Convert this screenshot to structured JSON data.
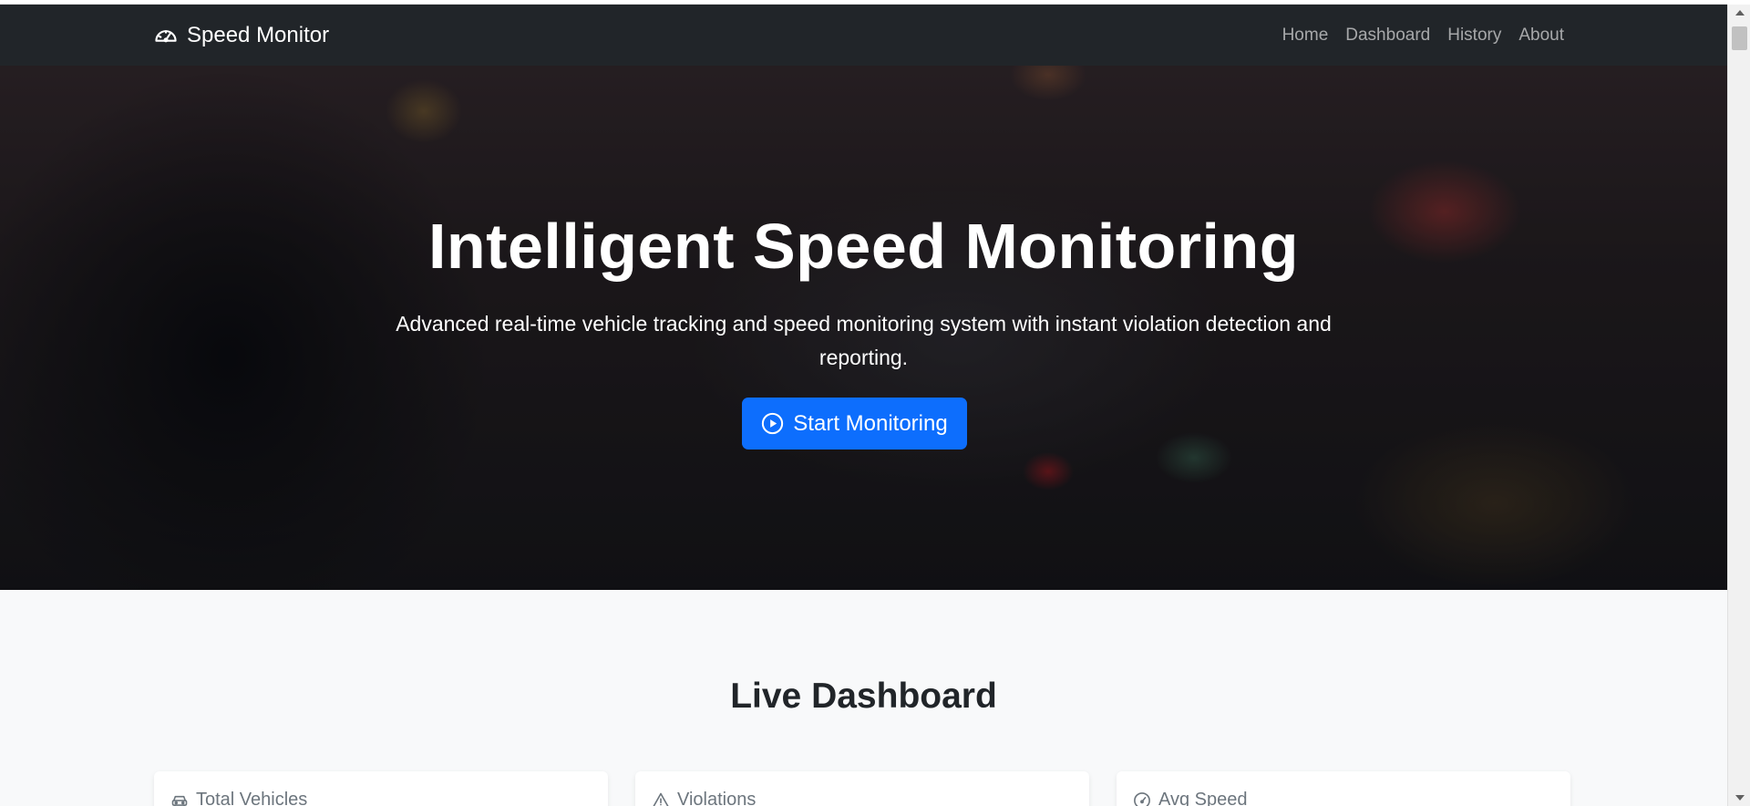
{
  "navbar": {
    "brand": "Speed Monitor",
    "brand_icon": "speedometer-icon",
    "links": [
      "Home",
      "Dashboard",
      "History",
      "About"
    ]
  },
  "hero": {
    "title": "Intelligent Speed Monitoring",
    "subtitle": "Advanced real-time vehicle tracking and speed monitoring system with instant violation detection and reporting.",
    "button_label": "Start Monitoring",
    "button_icon": "play-circle-icon",
    "button_color": "#0d6efd"
  },
  "dashboard": {
    "title": "Live Dashboard",
    "cards": [
      {
        "label": "Total Vehicles",
        "icon": "car-icon"
      },
      {
        "label": "Violations",
        "icon": "warning-icon"
      },
      {
        "label": "Avg Speed",
        "icon": "speedometer-icon"
      }
    ]
  },
  "colors": {
    "navbar_bg": "#212529",
    "accent": "#0d6efd",
    "page_bg": "#f8f9fa"
  }
}
